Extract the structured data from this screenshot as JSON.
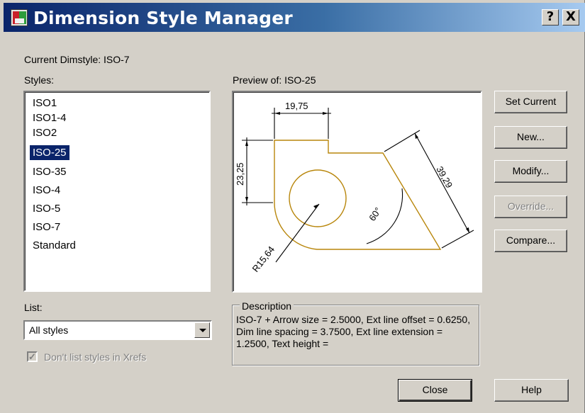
{
  "window": {
    "title": "Dimension Style Manager",
    "help_glyph": "?",
    "close_glyph": "X"
  },
  "current_dimstyle": "Current Dimstyle: ISO-7",
  "styles": {
    "label": "Styles:",
    "items": [
      "ISO1",
      "ISO1-4",
      "ISO2",
      "ISO-25",
      "ISO-35",
      "ISO-4",
      "ISO-5",
      "ISO-7",
      "Standard"
    ],
    "selected": "ISO-25"
  },
  "preview": {
    "label": "Preview of: ISO-25",
    "drawing": {
      "dim_top": "19,75",
      "dim_left": "23,25",
      "dim_slanted": "39,29",
      "dim_angle": "60°",
      "dim_radius": "R15,64",
      "line_color": "#b8860b"
    }
  },
  "description": {
    "legend": "Description",
    "text": "ISO-7 + Arrow size = 2.5000, Ext line offset = 0.6250, Dim line spacing = 3.7500, Ext line extension = 1.2500, Text height ="
  },
  "list": {
    "label": "List:",
    "selected": "All styles"
  },
  "checkbox": {
    "label": "Don't list styles in Xrefs",
    "checked": true,
    "enabled": false
  },
  "buttons": {
    "set_current": "Set Current",
    "new": "New...",
    "modify": "Modify...",
    "override": "Override...",
    "compare": "Compare...",
    "close": "Close",
    "help": "Help"
  }
}
